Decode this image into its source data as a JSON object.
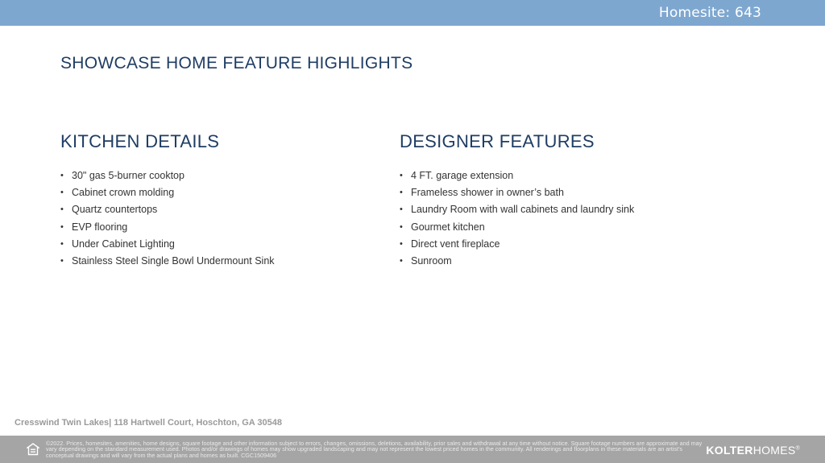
{
  "header": {
    "homesite": "Homesite: 643"
  },
  "title": "SHOWCASE HOME FEATURE HIGHLIGHTS",
  "kitchen": {
    "heading": "KITCHEN DETAILS",
    "items": [
      "30\" gas 5-burner cooktop",
      "Cabinet crown molding",
      "Quartz countertops",
      "EVP flooring",
      "Under Cabinet Lighting",
      "Stainless Steel Single Bowl Undermount Sink"
    ]
  },
  "designer": {
    "heading": "DESIGNER FEATURES",
    "items": [
      "4 FT. garage extension",
      "Frameless shower in owner’s bath",
      "Laundry Room with wall cabinets and laundry sink",
      "Gourmet kitchen",
      "Direct vent fireplace",
      "Sunroom"
    ]
  },
  "address": "Cresswind Twin Lakes| 118 Hartwell Court,  Hoschton, GA 30548",
  "footer": {
    "disclaimer": "©2022. Prices, homesites, amenities, home designs, square footage and other information subject to errors, changes, omissions, deletions, availability, prior sales and withdrawal at any time without notice. Square footage numbers are approximate and may vary depending on the standard measurement used. Photos and/or drawings of homes may show upgraded landscaping and may not represent the lowest priced homes in the community. All renderings and floorplans in these materials are an artist’s conceptual drawings and will vary from the actual plans and homes as built. CGC1509406",
    "logo_bold": "KOLTER",
    "logo_rest": "HOMES",
    "logo_mark": "®",
    "icon": "equal-housing-icon"
  },
  "colors": {
    "topbar": "#7ea7d0",
    "heading": "#1f3d63",
    "footer": "#a5a5a5"
  }
}
